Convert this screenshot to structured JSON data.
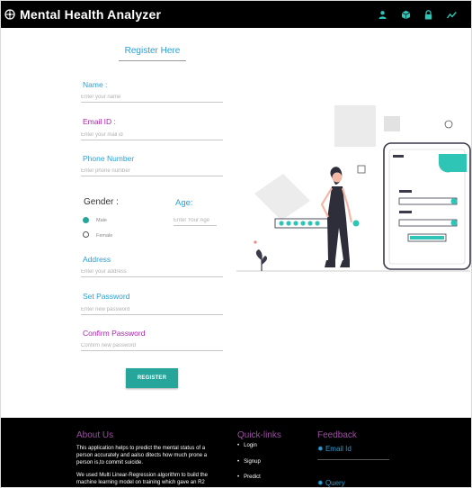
{
  "app": {
    "title": "Mental Health Analyzer"
  },
  "nav": {
    "icons": [
      "user-icon",
      "cube-icon",
      "lock-icon",
      "trend-icon"
    ],
    "accent": "#2ec4b6"
  },
  "form": {
    "title": "Register Here",
    "name": {
      "label": "Name :",
      "placeholder": "Enter your name"
    },
    "email": {
      "label": "Email ID :",
      "placeholder": "Enter your mail id"
    },
    "phone": {
      "label": "Phone Number",
      "placeholder": "Enter phone number"
    },
    "gender": {
      "label": "Gender :",
      "options": [
        "Male",
        "Female"
      ],
      "selected": "Male"
    },
    "age": {
      "label": "Age:",
      "placeholder": "Enter Your Age"
    },
    "address": {
      "label": "Address",
      "placeholder": "Enter your address"
    },
    "password": {
      "label": "Set Password",
      "placeholder": "Enter new password"
    },
    "confirm": {
      "label": "Confirm Password",
      "placeholder": "Confirm new password"
    },
    "submit_label": "REGISTER"
  },
  "footer": {
    "about": {
      "heading": "About Us",
      "para1": "This application helps to predict the mental status of a person accurately and aalso ditects how much prone a person is,to commit suicide.",
      "para2": "We used Multi Linear-Regression algorithm to build the machine learning model on training which gave an R2"
    },
    "quick": {
      "heading": "Quick-links",
      "items": [
        "Login",
        "Signup",
        "Predict"
      ]
    },
    "feedback": {
      "heading": "Feedback",
      "email_label": "Email Id",
      "query_label": "Query"
    }
  },
  "colors": {
    "teal": "#26a69a",
    "blue": "#2a9fd6",
    "purple": "#b020b0",
    "navbar": "#000000"
  }
}
